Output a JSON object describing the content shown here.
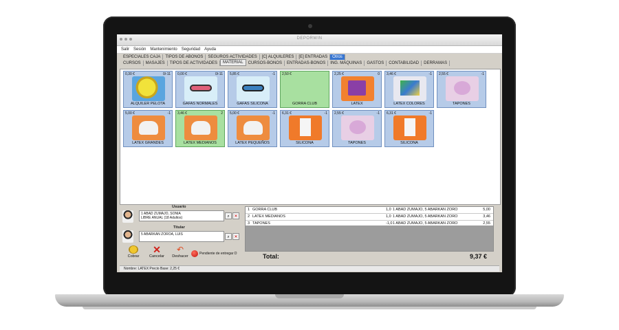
{
  "window": {
    "title": "DEPORWIN"
  },
  "menu": [
    "Salir",
    "Sesión",
    "Mantenimiento",
    "Seguridad",
    "Ayuda"
  ],
  "tabs_row1": [
    {
      "label": "ESPECIALES CAJA",
      "active": false
    },
    {
      "label": "TIPOS DE ABONOS",
      "active": false
    },
    {
      "label": "SEGUROS ACTIVIDADES",
      "active": false
    },
    {
      "label": "[C] ALQUILERES",
      "active": false
    },
    {
      "label": "[E] ENTRADAS",
      "active": false
    },
    {
      "label": "Otros",
      "active": true
    }
  ],
  "tabs_row2": [
    {
      "label": "CURSOS",
      "selected": false
    },
    {
      "label": "MASAJES",
      "selected": false
    },
    {
      "label": "TIPOS DE ACTIVIDADES",
      "selected": false
    },
    {
      "label": "MATERIAL",
      "selected": true
    },
    {
      "label": "CURSOS-BONOS",
      "selected": false
    },
    {
      "label": "ENTRADAS-BONOS",
      "selected": false
    },
    {
      "label": "ING. MÁQUINAS",
      "selected": false
    },
    {
      "label": "GASTOS",
      "selected": false
    },
    {
      "label": "CONTABILIDAD",
      "selected": false
    },
    {
      "label": "DERRAMAS",
      "selected": false
    }
  ],
  "products": [
    {
      "price": "0,30 €",
      "stock": "0/-11",
      "name": "ALQUILER PELOTA",
      "icon": "tennis-ball-icon",
      "img": "img-ball",
      "color": "blue"
    },
    {
      "price": "0,00 €",
      "stock": "0/-11",
      "name": "GAFAS NORMALES",
      "icon": "pink-goggles-icon",
      "img": "img-goggle-pink",
      "color": "blue"
    },
    {
      "price": "5,85 €",
      "stock": "-1",
      "name": "GAFAS SILICONA",
      "icon": "blue-goggles-icon",
      "img": "img-goggle-blue",
      "color": "blue"
    },
    {
      "price": "2,50 €",
      "stock": "",
      "name": "GORRA CLUB",
      "icon": "",
      "img": "",
      "color": "green"
    },
    {
      "price": "2,25 €",
      "stock": "0",
      "name": "LATEX",
      "icon": "latex-cap-icon",
      "img": "img-latex",
      "color": "blue"
    },
    {
      "price": "3,46 €",
      "stock": "-1",
      "name": "LATEX COLORES",
      "icon": "latex-colors-icon",
      "img": "img-latexc",
      "color": "blue"
    },
    {
      "price": "2,55 €",
      "stock": "-1",
      "name": "TAPONES",
      "icon": "earplugs-icon",
      "img": "img-tapon",
      "color": "blue"
    },
    {
      "price": "5,00 €",
      "stock": "-1",
      "name": "LATEX GRANDES",
      "icon": "white-cap-icon",
      "img": "img-cap-orange",
      "color": "blue"
    },
    {
      "price": "3,46 €",
      "stock": "2",
      "name": "LATEX MEDIANOS",
      "icon": "white-cap-icon",
      "img": "img-cap-orange",
      "color": "green"
    },
    {
      "price": "5,00 €",
      "stock": "-1",
      "name": "LATEX PEQUEÑOS",
      "icon": "white-cap-icon",
      "img": "img-cap-orange",
      "color": "blue"
    },
    {
      "price": "6,31 €",
      "stock": "-1",
      "name": "SILICONA",
      "icon": "silicone-cap-icon",
      "img": "img-shirt",
      "color": "blue"
    },
    {
      "price": "2,55 €",
      "stock": "-1",
      "name": "TAPONES",
      "icon": "earplugs-icon",
      "img": "img-tapon",
      "color": "blue"
    },
    {
      "price": "6,31 €",
      "stock": "-1",
      "name": "SILICONA",
      "icon": "silicone-cap-icon",
      "img": "img-shirt",
      "color": "blue"
    }
  ],
  "usuario": {
    "label": "Usuario",
    "line1": "1 ABAD ZUMAJO, SONIA",
    "line2": "LIBRE ANUAL (18 Adultos)"
  },
  "titular": {
    "label": "Titular",
    "line1": "5 ABARKAN ZOROA, LUIS"
  },
  "actions": {
    "cobrar": "Cobrar",
    "cancelar": "Cancelar",
    "deshacer": "Deshacer",
    "pendiente": "Pendiente de entregar D"
  },
  "ticket": [
    {
      "n": "1",
      "name": "GORRA CLUB",
      "qty": "1,0",
      "user": "1 ABAD ZUMAJO, 5 ABARKAN ZORO",
      "amount": "5,00"
    },
    {
      "n": "2",
      "name": "LATEX MEDIANOS",
      "qty": "1,0",
      "user": "1 ABAD ZUMAJO, 5 ABARKAN ZORO",
      "amount": "3,46"
    },
    {
      "n": "3",
      "name": "TAPONES",
      "qty": "-1,0",
      "user": "1 ABAD ZUMAJO, 5 ABARKAN ZORO",
      "amount": "2,55"
    }
  ],
  "total": {
    "label": "Total:",
    "value": "9,37 €"
  },
  "status": "Nombre: LATEX   Precio Base: 2,25 €"
}
